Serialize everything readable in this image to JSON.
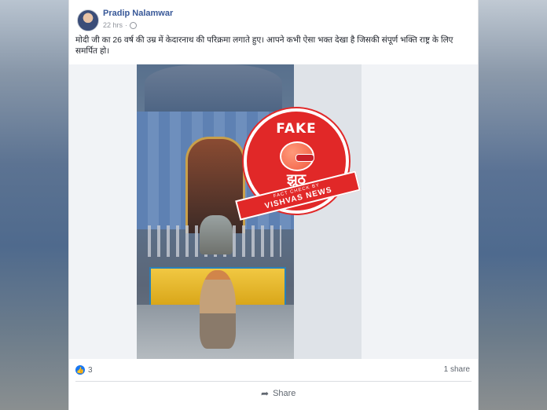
{
  "post": {
    "author": "Pradip Nalamwar",
    "time": "22 hrs",
    "caption": "मोदी जी का 26 वर्ष की उम्र में केदारनाथ की परिक्रमा लगाते हुए। आपने कभी ऐसा भक्त देखा है जिसकी संपूर्ण भक्ति राष्ट्र के लिए समर्पित हो।",
    "reactions_count": "3",
    "shares": "1 share",
    "share_label": "Share"
  },
  "stamp": {
    "fake": "FAKE",
    "jhooth": "झूठ",
    "fact_check": "FACT CHECK BY",
    "brand": "VISHVAS NEWS"
  },
  "icons": {
    "avatar": "profile-photo",
    "privacy": "globe-icon",
    "like": "thumbs-up-icon",
    "share": "share-arrow-icon"
  },
  "colors": {
    "author": "#385898",
    "stamp": "#e12828",
    "like": "#1877f2"
  }
}
